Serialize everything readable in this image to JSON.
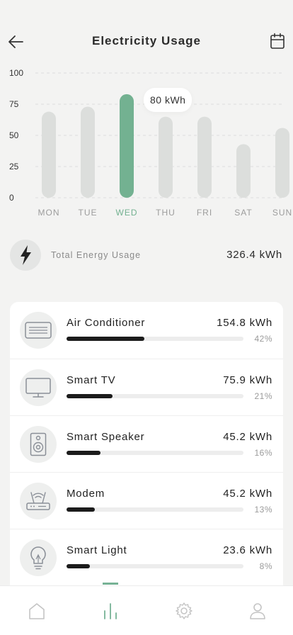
{
  "header": {
    "title": "Electricity Usage"
  },
  "chart_data": {
    "type": "bar",
    "categories": [
      "MON",
      "TUE",
      "WED",
      "THU",
      "FRI",
      "SAT",
      "SUN"
    ],
    "values": [
      69,
      73,
      83,
      65,
      65,
      43,
      56
    ],
    "highlight_index": 2,
    "tooltip": "80 kWh",
    "yticks": [
      0,
      25,
      50,
      75,
      100
    ],
    "ylim": [
      0,
      100
    ],
    "grid": true,
    "colors": {
      "bar": "#dcdedc",
      "highlight": "#73b191",
      "axis_label": "#9c9c9c",
      "highlight_label": "#73b191"
    }
  },
  "total": {
    "label": "Total Energy Usage",
    "value": "326.4 kWh"
  },
  "devices": [
    {
      "name": "Air Conditioner",
      "value": "154.8 kWh",
      "percent": "42%",
      "fill": 0.44
    },
    {
      "name": "Smart TV",
      "value": "75.9 kWh",
      "percent": "21%",
      "fill": 0.26
    },
    {
      "name": "Smart Speaker",
      "value": "45.2 kWh",
      "percent": "16%",
      "fill": 0.19
    },
    {
      "name": "Modem",
      "value": "45.2 kWh",
      "percent": "13%",
      "fill": 0.16
    },
    {
      "name": "Smart Light",
      "value": "23.6 kWh",
      "percent": "8%",
      "fill": 0.13
    }
  ],
  "icons": {
    "back": "arrow-left-icon",
    "calendar": "calendar-icon",
    "bolt": "lightning-bolt-icon",
    "nav": [
      "home-icon",
      "chart-icon",
      "gear-icon",
      "user-icon"
    ]
  },
  "nav": {
    "active_index": 1,
    "active_color": "#77b295",
    "inactive_color": "#c4c4c4"
  }
}
